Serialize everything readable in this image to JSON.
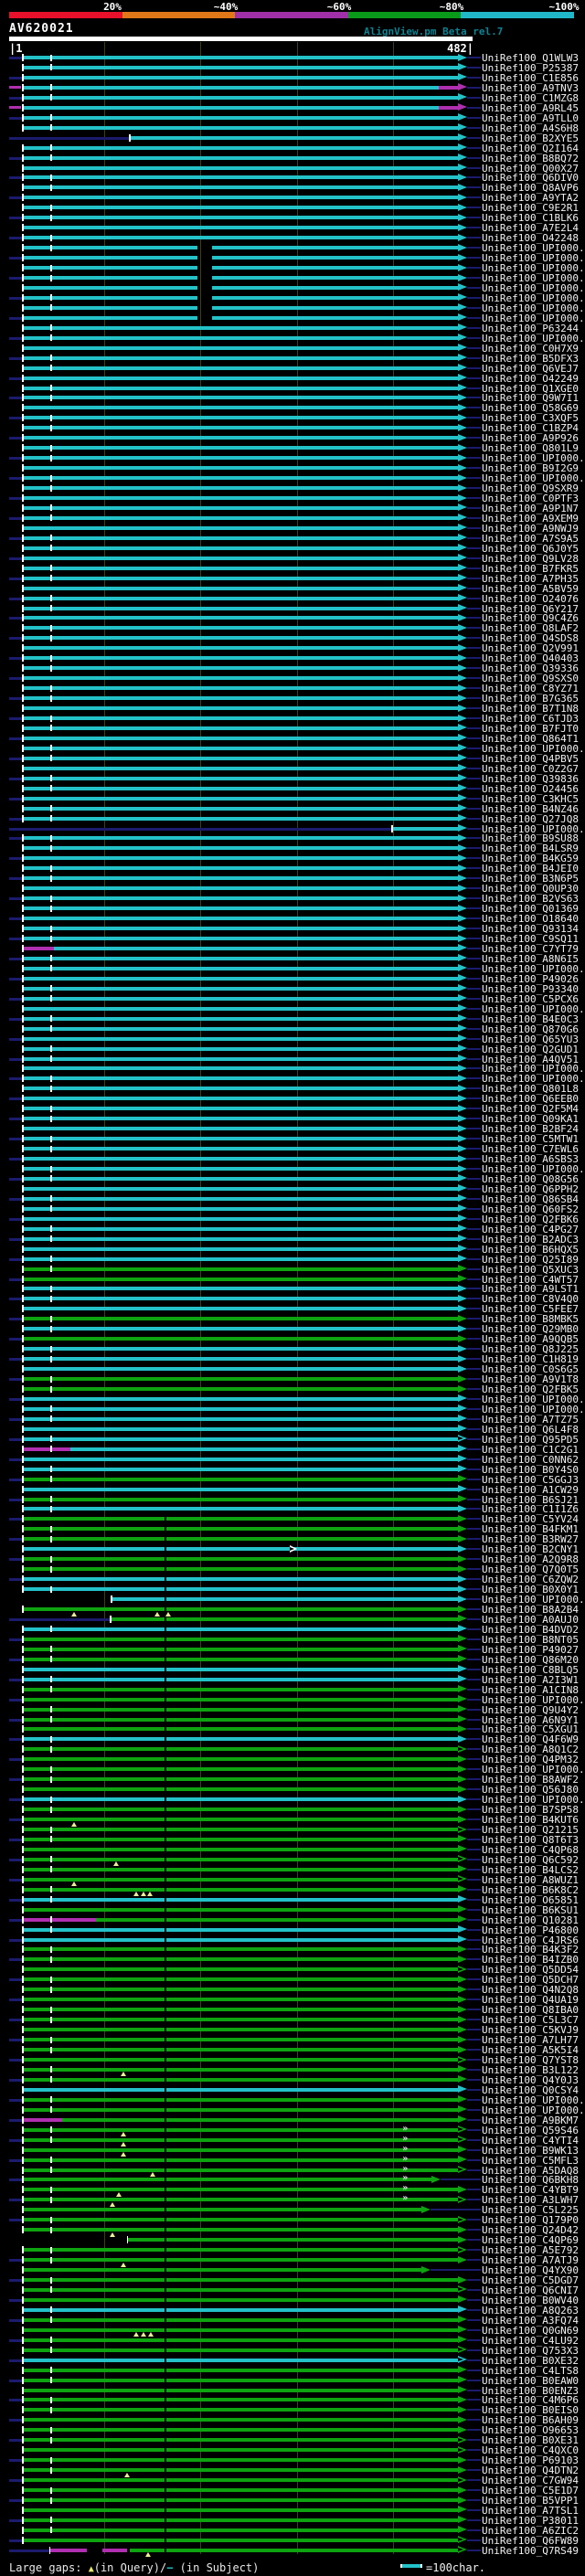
{
  "header": {
    "query_id": "AV620021",
    "tool_note": "AlignView.pm Beta rel.7"
  },
  "identity_scale": {
    "labels": [
      "20%",
      "~40%",
      "~60%",
      "~80%",
      "~100%"
    ],
    "colors": [
      "#e8102a",
      "#e07818",
      "#a030a8",
      "#0a9a1a",
      "#20b8c8"
    ],
    "label_centers": [
      123,
      247,
      371,
      494,
      617
    ]
  },
  "ruler": {
    "start_label": "|1",
    "end_label": "482|"
  },
  "footer": {
    "prefix": "Large gaps: ",
    "query_symbol": "▲",
    "query_text": "(in Query)/",
    "subject_symbol": "−",
    "subject_text": " (in Subject)",
    "unit_label": "=100char."
  },
  "colors": {
    "cyan": "#23c2c8",
    "green": "#0ea310",
    "magenta": "#b02fb0",
    "navy": "#1b1b6e",
    "grid": "#3f3f18",
    "tick": "#ffffff",
    "gap_triangle": "#eeee99",
    "chevron": "#ead6ea",
    "label": "#f2f2f2"
  },
  "chart_data": {
    "type": "bar",
    "orientation": "horizontal",
    "title": "AV620021",
    "x_range": [
      1,
      482
    ],
    "gridlines_x": [
      100,
      200,
      300,
      400
    ],
    "unit_note": "=100char.",
    "legend": "color = percent identity (20% red, ~40% orange, ~60% magenta, ~80% green, ~100% cyan)",
    "id_prefix": "UniRef100_",
    "default_span": [
      16,
      468
    ],
    "rows": [
      [
        "Q1WLW3",
        "c"
      ],
      [
        "P25387",
        "c"
      ],
      [
        "C1E856",
        "c"
      ],
      [
        "A9TNV3",
        "c",
        {
          "seg": [
            [
              16,
              448,
              "c"
            ],
            [
              448,
              468,
              "m"
            ]
          ],
          "pre": [
            1,
            13
          ]
        }
      ],
      [
        "C1MZG8",
        "c"
      ],
      [
        "A9RL45",
        "c",
        {
          "seg": [
            [
              16,
              448,
              "c"
            ],
            [
              448,
              468,
              "m"
            ]
          ],
          "pre": [
            1,
            13
          ]
        }
      ],
      [
        "A9TLL0",
        "c"
      ],
      [
        "A4S6H8",
        "c"
      ],
      [
        "B2XYE5",
        "c",
        {
          "lead": [
            1,
            126
          ],
          "s": 127
        }
      ],
      [
        "Q2I164",
        "c"
      ],
      [
        "B8BQ72",
        "c"
      ],
      [
        "Q00X27",
        "c"
      ],
      [
        "Q6DIV0",
        "c"
      ],
      [
        "Q8AVP6",
        "c"
      ],
      [
        "A9YTA2",
        "c"
      ],
      [
        "C9E2R1",
        "c"
      ],
      [
        "C1BLK6",
        "c"
      ],
      [
        "A7E2L4",
        "c"
      ],
      [
        "O42248",
        "c"
      ],
      [
        "UPI000..",
        "c",
        {
          "gap": [
            197,
            212
          ]
        }
      ],
      [
        "UPI000..",
        "c",
        {
          "gap": [
            197,
            212
          ]
        }
      ],
      [
        "UPI000..",
        "c",
        {
          "gap": [
            197,
            212
          ]
        }
      ],
      [
        "UPI000..",
        "c",
        {
          "gap": [
            197,
            212
          ]
        }
      ],
      [
        "UPI000..",
        "c",
        {
          "gap": [
            197,
            212
          ]
        }
      ],
      [
        "UPI000..",
        "c",
        {
          "gap": [
            197,
            212
          ]
        }
      ],
      [
        "UPI000..",
        "c",
        {
          "gap": [
            197,
            212
          ]
        }
      ],
      [
        "UPI000..",
        "c",
        {
          "gap": [
            197,
            212
          ]
        }
      ],
      [
        "P63244",
        "c"
      ],
      [
        "UPI000..",
        "c"
      ],
      [
        "C0H7X9",
        "c"
      ],
      [
        "B5DFX3",
        "c"
      ],
      [
        "Q6VEJ7",
        "c"
      ],
      [
        "O42249",
        "c"
      ],
      [
        "Q1XGE0",
        "c"
      ],
      [
        "Q9W7I1",
        "c"
      ],
      [
        "Q58G69",
        "c"
      ],
      [
        "C3XQF5",
        "c"
      ],
      [
        "C1BZP4",
        "c"
      ],
      [
        "A9P926",
        "c"
      ],
      [
        "Q801L9",
        "c"
      ],
      [
        "UPI000..",
        "c"
      ],
      [
        "B9I2G9",
        "c"
      ],
      [
        "UPI000..",
        "c"
      ],
      [
        "Q9SXR9",
        "c"
      ],
      [
        "C0PTF3",
        "c"
      ],
      [
        "A9P1N7",
        "c"
      ],
      [
        "A9XEM9",
        "c"
      ],
      [
        "A9NWJ9",
        "c"
      ],
      [
        "A7S9A5",
        "c"
      ],
      [
        "Q6J0Y5",
        "c"
      ],
      [
        "Q9LV28",
        "c"
      ],
      [
        "B7FKR5",
        "c"
      ],
      [
        "A7PH35",
        "c"
      ],
      [
        "A5BV59",
        "c"
      ],
      [
        "O24076",
        "c"
      ],
      [
        "Q6Y217",
        "c"
      ],
      [
        "Q9C4Z6",
        "c"
      ],
      [
        "Q8LAF2",
        "c"
      ],
      [
        "Q4SDS8",
        "c"
      ],
      [
        "Q2V991",
        "c"
      ],
      [
        "Q40403",
        "c"
      ],
      [
        "Q39336",
        "c"
      ],
      [
        "Q9SXS0",
        "c"
      ],
      [
        "C8YZ71",
        "c"
      ],
      [
        "B7G365",
        "c"
      ],
      [
        "B7T1N8",
        "c"
      ],
      [
        "C6TJD3",
        "c"
      ],
      [
        "B7FJT0",
        "c"
      ],
      [
        "Q864T1",
        "c"
      ],
      [
        "UPI000..",
        "c"
      ],
      [
        "Q4PBV5",
        "c"
      ],
      [
        "C0Z2G7",
        "c"
      ],
      [
        "Q39836",
        "c"
      ],
      [
        "O24456",
        "c"
      ],
      [
        "C3KHC5",
        "c"
      ],
      [
        "B4NZ46",
        "c"
      ],
      [
        "Q27JQ8",
        "c"
      ],
      [
        "UPI000..",
        "c",
        {
          "lead": [
            1,
            398
          ],
          "s": 400
        }
      ],
      [
        "B9SU88",
        "c"
      ],
      [
        "B4LSR9",
        "c"
      ],
      [
        "B4KG59",
        "c"
      ],
      [
        "B4JEI0",
        "c"
      ],
      [
        "B3N6P5",
        "c"
      ],
      [
        "Q0UP30",
        "c"
      ],
      [
        "B2VS63",
        "c"
      ],
      [
        "Q01369",
        "c"
      ],
      [
        "O18640",
        "c"
      ],
      [
        "Q93134",
        "c"
      ],
      [
        "C9SQ11",
        "c"
      ],
      [
        "C7YT79",
        "c",
        {
          "seg": [
            [
              16,
              48,
              "m"
            ],
            [
              48,
              468,
              "c"
            ]
          ]
        }
      ],
      [
        "A8N6I5",
        "c"
      ],
      [
        "UPI000..",
        "c"
      ],
      [
        "P49026",
        "c"
      ],
      [
        "P93340",
        "c"
      ],
      [
        "C5PCX6",
        "c"
      ],
      [
        "UPI000..",
        "c"
      ],
      [
        "B4E0C3",
        "c"
      ],
      [
        "Q870G6",
        "c"
      ],
      [
        "Q65YU3",
        "c"
      ],
      [
        "Q2GUD1",
        "c"
      ],
      [
        "A4QV51",
        "c"
      ],
      [
        "UPI000..",
        "c"
      ],
      [
        "UPI000..",
        "c"
      ],
      [
        "Q801L8",
        "c"
      ],
      [
        "Q6EEB0",
        "c"
      ],
      [
        "Q2F5M4",
        "c"
      ],
      [
        "Q09KA1",
        "c"
      ],
      [
        "B2BF24",
        "c"
      ],
      [
        "C5MTW1",
        "c"
      ],
      [
        "C7EWL6",
        "c"
      ],
      [
        "A6SBS3",
        "c"
      ],
      [
        "UPI000..",
        "c"
      ],
      [
        "Q08G56",
        "c"
      ],
      [
        "Q6PPH2",
        "c"
      ],
      [
        "Q86SB4",
        "c"
      ],
      [
        "Q60FS2",
        "c"
      ],
      [
        "Q2FBK6",
        "c"
      ],
      [
        "C4PG27",
        "c"
      ],
      [
        "B2ADC3",
        "c"
      ],
      [
        "B6HQX5",
        "c"
      ],
      [
        "Q25I89",
        "c"
      ],
      [
        "Q5XUC3",
        "g"
      ],
      [
        "C4WT57",
        "g"
      ],
      [
        "A9LST1",
        "c"
      ],
      [
        "C8V4Q0",
        "c"
      ],
      [
        "C5FEE7",
        "c"
      ],
      [
        "B8MBK5",
        "g"
      ],
      [
        "Q29MB0",
        "c"
      ],
      [
        "A9QQB5",
        "g"
      ],
      [
        "Q8J225",
        "c"
      ],
      [
        "C1H819",
        "c"
      ],
      [
        "C0S6G5",
        "c"
      ],
      [
        "A9V1T8",
        "g"
      ],
      [
        "Q2FBK5",
        "g"
      ],
      [
        "UPI000..",
        "c"
      ],
      [
        "UPI000..",
        "c"
      ],
      [
        "A7TZ75",
        "c"
      ],
      [
        "Q6L4F8",
        "c"
      ],
      [
        "Q95PD5",
        "c",
        {
          "hol": 1
        }
      ],
      [
        "C1C2G1",
        "c",
        {
          "seg": [
            [
              16,
              65,
              "m"
            ],
            [
              65,
              468,
              "c"
            ]
          ]
        }
      ],
      [
        "C0NN62",
        "c"
      ],
      [
        "B0Y4S0",
        "c"
      ],
      [
        "C5GGJ3",
        "g"
      ],
      [
        "A1CW29",
        "c"
      ],
      [
        "B6SJ21",
        "g"
      ],
      [
        "C1I1Z6",
        "c"
      ],
      [
        "C5YV24",
        "g"
      ],
      [
        "B4FKM1",
        "g"
      ],
      [
        "B3RW27",
        "g"
      ],
      [
        "B2CNY1",
        "c",
        {
          "mid": 293
        }
      ],
      [
        "A2Q9R8",
        "g"
      ],
      [
        "Q7Q0T5",
        "g"
      ],
      [
        "C6ZQW2",
        "c"
      ],
      [
        "B0X0Y1",
        "c"
      ],
      [
        "UPI000..",
        "c",
        {
          "s": 108,
          "lead": 0
        }
      ],
      [
        "B8A2B4",
        "g",
        {
          "tri": [
            69,
            155,
            167
          ]
        }
      ],
      [
        "A0AUJ0",
        "g",
        {
          "lead": [
            1,
            106
          ],
          "s": 107
        }
      ],
      [
        "B4DVD2",
        "c"
      ],
      [
        "B8NT05",
        "g"
      ],
      [
        "P49027",
        "g"
      ],
      [
        "Q86M20",
        "g"
      ],
      [
        "C8BLQ5",
        "c"
      ],
      [
        "A2I3W1",
        "c"
      ],
      [
        "A1CIN8",
        "g"
      ],
      [
        "UPI000..",
        "g"
      ],
      [
        "Q9U4Y2",
        "g"
      ],
      [
        "A6N9Y1",
        "g"
      ],
      [
        "C5XGU1",
        "g"
      ],
      [
        "Q4F6W9",
        "c"
      ],
      [
        "A8Q1C2",
        "g",
        {
          "hol": 1
        }
      ],
      [
        "Q4PM32",
        "g"
      ],
      [
        "UPI000..",
        "g"
      ],
      [
        "B8AWF2",
        "g"
      ],
      [
        "Q56J80",
        "g"
      ],
      [
        "UPI000..",
        "c"
      ],
      [
        "B7SP58",
        "g"
      ],
      [
        "B4KUT6",
        "g",
        {
          "tri": [
            69
          ]
        }
      ],
      [
        "Q21215",
        "g",
        {
          "hol": 1
        }
      ],
      [
        "Q8T6T3",
        "g"
      ],
      [
        "C4QP68",
        "g"
      ],
      [
        "Q6C592",
        "g",
        {
          "hol": 1,
          "tri": [
            113
          ]
        }
      ],
      [
        "B4LCS2",
        "g"
      ],
      [
        "A8WUZ1",
        "g",
        {
          "hol": 1,
          "tri": [
            69
          ]
        }
      ],
      [
        "B6K8C2",
        "g",
        {
          "tri": [
            134,
            141,
            148
          ]
        }
      ],
      [
        "O65851",
        "c"
      ],
      [
        "B6KSU1",
        "g"
      ],
      [
        "Q10281",
        "g",
        {
          "seg": [
            [
              16,
              91,
              "m"
            ],
            [
              91,
              468,
              "g"
            ]
          ]
        }
      ],
      [
        "P46800",
        "c"
      ],
      [
        "C4JRS6",
        "c"
      ],
      [
        "B4K3F2",
        "g"
      ],
      [
        "B4IZB0",
        "g"
      ],
      [
        "Q5DD54",
        "g",
        {
          "hol": 1
        }
      ],
      [
        "Q5DCH7",
        "g"
      ],
      [
        "Q4N2Q8",
        "g"
      ],
      [
        "Q4UA19",
        "g"
      ],
      [
        "Q8IBA0",
        "g"
      ],
      [
        "C5L3C7",
        "g"
      ],
      [
        "C5KVJ9",
        "g"
      ],
      [
        "A7LH77",
        "g"
      ],
      [
        "A5K5I4",
        "g"
      ],
      [
        "Q7YST8",
        "g",
        {
          "hol": 1
        }
      ],
      [
        "B3L122",
        "g",
        {
          "tri": [
            120
          ]
        }
      ],
      [
        "Q4Y0J3",
        "g"
      ],
      [
        "Q0CSY4",
        "c"
      ],
      [
        "UPI000..",
        "g"
      ],
      [
        "UPI000..",
        "g"
      ],
      [
        "A9BKM7",
        "g",
        {
          "seg": [
            [
              16,
              56,
              "m"
            ],
            [
              56,
              468,
              "g"
            ]
          ]
        }
      ],
      [
        "Q59S46",
        "g",
        {
          "hol": 1,
          "tri": [
            120
          ],
          "chev": 1
        }
      ],
      [
        "C4YTI4",
        "g",
        {
          "hol": 1,
          "tri": [
            120
          ],
          "chev": 1
        }
      ],
      [
        "B9WK13",
        "g",
        {
          "tri": [
            120
          ],
          "chev": 1
        }
      ],
      [
        "C5MFL3",
        "g",
        {
          "chev": 1
        }
      ],
      [
        "A5DAQ8",
        "g",
        {
          "hol": 1,
          "tri": [
            151
          ],
          "chev": 1
        }
      ],
      [
        "Q6BKH8",
        "g",
        {
          "e": 440,
          "chev": 1
        }
      ],
      [
        "C4YBT9",
        "g",
        {
          "tri": [
            116
          ],
          "chev": 1
        }
      ],
      [
        "A3LWH7",
        "g",
        {
          "hol": 1,
          "tri": [
            109
          ],
          "chev": 1
        }
      ],
      [
        "C5L225",
        "g",
        {
          "e": 430
        }
      ],
      [
        "Q179P0",
        "g",
        {
          "hol": 1
        }
      ],
      [
        "Q24D42",
        "g",
        {
          "tri": [
            109
          ]
        }
      ],
      [
        "C4QP69",
        "g",
        {
          "s": 125,
          "lead": 0
        }
      ],
      [
        "A5E792",
        "g",
        {
          "hol": 1
        }
      ],
      [
        "A7ATJ9",
        "g",
        {
          "tri": [
            120
          ]
        }
      ],
      [
        "Q4YX90",
        "g",
        {
          "e": 430
        }
      ],
      [
        "C5DGD7",
        "g"
      ],
      [
        "Q6CNI7",
        "g",
        {
          "hol": 1
        }
      ],
      [
        "B0WV40",
        "g"
      ],
      [
        "A8Q263",
        "c"
      ],
      [
        "A3FQ74",
        "g"
      ],
      [
        "Q0GN69",
        "g",
        {
          "tri": [
            134,
            141,
            149
          ]
        }
      ],
      [
        "C4LU92",
        "g"
      ],
      [
        "Q753X3",
        "g",
        {
          "hol": 1
        }
      ],
      [
        "B0XE32",
        "c",
        {
          "hol": 1
        }
      ],
      [
        "C4LTS8",
        "g"
      ],
      [
        "B0EAW0",
        "g"
      ],
      [
        "B0ENZ3",
        "g"
      ],
      [
        "C4M6P6",
        "g"
      ],
      [
        "B0EIS0",
        "g"
      ],
      [
        "B6AH09",
        "g"
      ],
      [
        "O96653",
        "g"
      ],
      [
        "B0XE31",
        "g",
        {
          "hol": 1
        }
      ],
      [
        "C4QXC0",
        "g",
        {
          "hol": 1
        }
      ],
      [
        "P69103",
        "g"
      ],
      [
        "Q4DTN2",
        "g",
        {
          "tri": [
            124
          ]
        }
      ],
      [
        "C7GW94",
        "g",
        {
          "hol": 1
        }
      ],
      [
        "C5E1D7",
        "g"
      ],
      [
        "B5VPP1",
        "g"
      ],
      [
        "A7TSL1",
        "g"
      ],
      [
        "P38011",
        "g"
      ],
      [
        "A6ZIC2",
        "g"
      ],
      [
        "Q6FW89",
        "g",
        {
          "hol": 1
        }
      ],
      [
        "Q7RS49",
        "g",
        {
          "lead": [
            1,
            44
          ],
          "seg": [
            [
              44,
              82,
              "m"
            ],
            [
              98,
              124,
              "m"
            ],
            [
              126,
              468,
              "g"
            ]
          ],
          "hol": 1,
          "tri": [
            146
          ]
        }
      ]
    ]
  }
}
